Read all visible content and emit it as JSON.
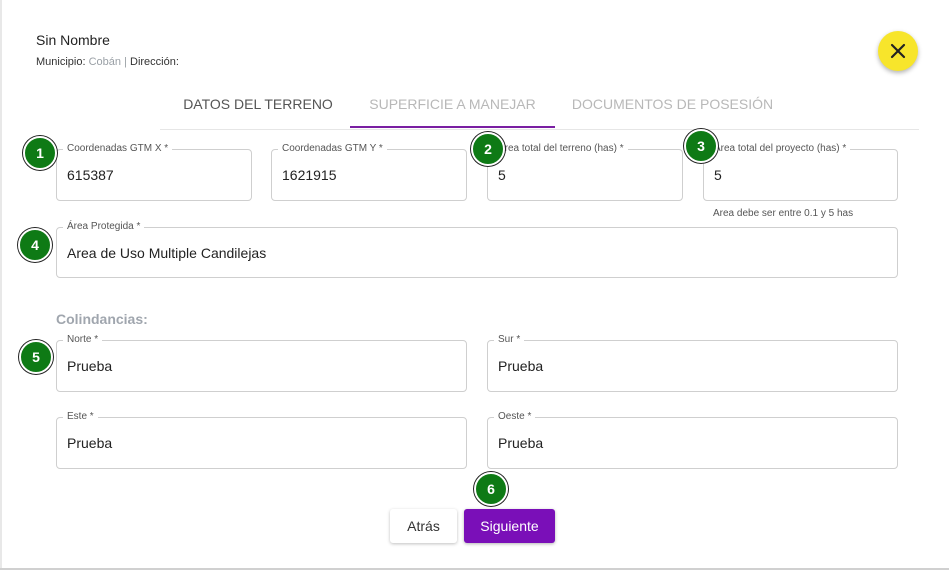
{
  "header": {
    "owner_name": "Sin Nombre",
    "municipio_label": "Municipio:",
    "municipio_value": "Cobán",
    "separator": "|",
    "direccion_label": "Dirección:"
  },
  "tabs": [
    {
      "label": "DATOS DEL TERRENO"
    },
    {
      "label": "SUPERFICIE A MANEJAR"
    },
    {
      "label": "DOCUMENTOS DE POSESIÓN"
    }
  ],
  "fields": {
    "gtm_x": {
      "label": "Coordenadas GTM X *",
      "value": "615387"
    },
    "gtm_y": {
      "label": "Coordenadas GTM Y *",
      "value": "1621915"
    },
    "area_terreno": {
      "label": "Área total del terreno (has) *",
      "value": "5"
    },
    "area_proyecto": {
      "label": "Área total del proyecto (has) *",
      "value": "5",
      "hint": "Area debe ser entre 0.1 y 5 has"
    },
    "area_protegida": {
      "label": "Área Protegida *",
      "value": "Area de Uso Multiple Candilejas"
    }
  },
  "colindancias": {
    "title": "Colindancias:",
    "norte": {
      "label": "Norte *",
      "value": "Prueba"
    },
    "sur": {
      "label": "Sur *",
      "value": "Prueba"
    },
    "este": {
      "label": "Este *",
      "value": "Prueba"
    },
    "oeste": {
      "label": "Oeste *",
      "value": "Prueba"
    }
  },
  "badges": [
    "1",
    "2",
    "3",
    "4",
    "5",
    "6"
  ],
  "buttons": {
    "back": "Atrás",
    "next": "Siguiente"
  },
  "colors": {
    "accent": "#7a0fb8",
    "close": "#f7e52b",
    "badge": "#0e7a15"
  },
  "icons": {
    "close": "close-icon"
  }
}
